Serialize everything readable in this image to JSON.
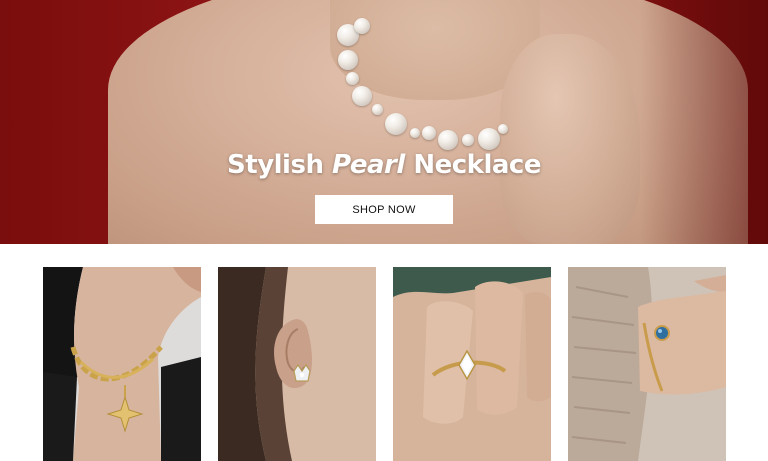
{
  "hero": {
    "title_part1": "Stylish ",
    "title_italic": "Pearl",
    "title_part2": " Necklace",
    "cta_label": "SHOP NOW",
    "background_color": "#8a1212"
  },
  "products": [
    {
      "name": "necklace-tile"
    },
    {
      "name": "earring-tile"
    },
    {
      "name": "ring-tile"
    },
    {
      "name": "bracelet-tile"
    }
  ]
}
